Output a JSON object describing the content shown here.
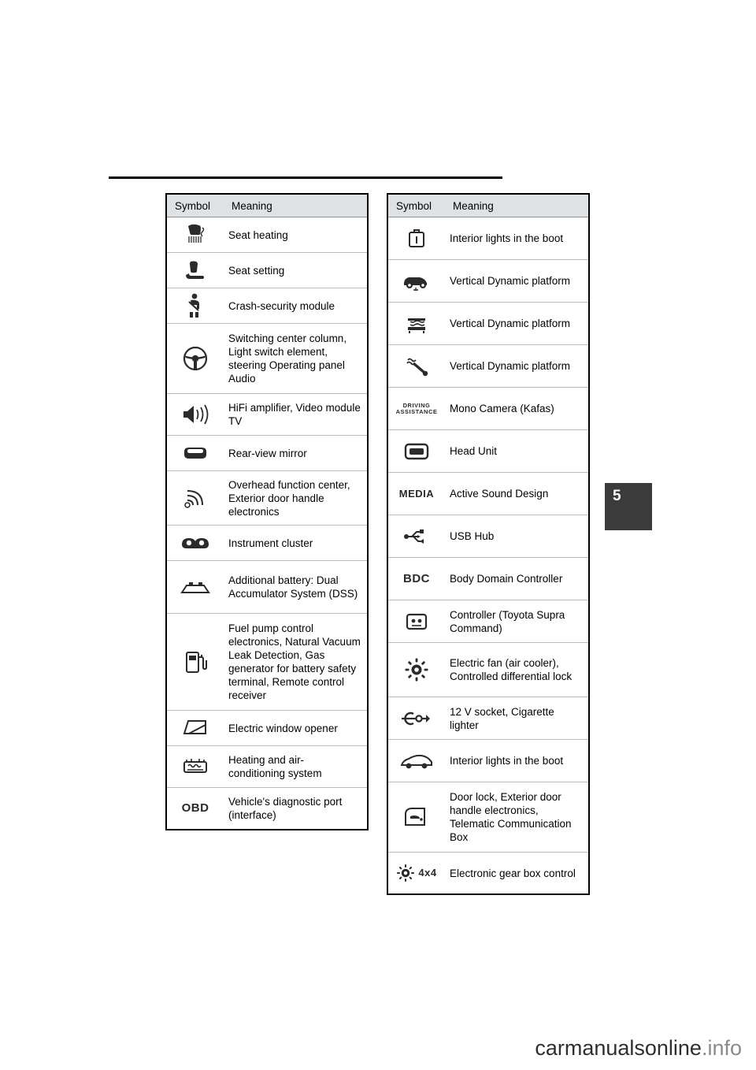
{
  "page": {
    "tab_number": "5",
    "watermark_main": "carmanualsonline",
    "watermark_suffix": ".info"
  },
  "tables": [
    {
      "id": "left",
      "header": {
        "symbol": "Symbol",
        "meaning": "Meaning"
      },
      "rows": [
        {
          "icon": "seat-heating-icon",
          "meaning": "Seat heating"
        },
        {
          "icon": "seat-setting-icon",
          "meaning": "Seat setting"
        },
        {
          "icon": "crash-security-module-icon",
          "meaning": "Crash-security module"
        },
        {
          "icon": "steering-wheel-icon",
          "meaning": "Switching center column, Light switch element, steering Operating panel Audio"
        },
        {
          "icon": "speaker-icon",
          "meaning": "HiFi amplifier, Video module TV"
        },
        {
          "icon": "rear-view-mirror-icon",
          "meaning": "Rear-view mirror"
        },
        {
          "icon": "antenna-signal-icon",
          "meaning": "Overhead function center, Exterior door handle electronics"
        },
        {
          "icon": "instrument-cluster-icon",
          "meaning": "Instrument cluster"
        },
        {
          "icon": "additional-battery-icon",
          "meaning": "Additional battery: Dual Accumulator System (DSS)"
        },
        {
          "icon": "fuel-pump-icon",
          "meaning": "Fuel pump control electronics, Natural Vacuum Leak Detection, Gas generator for battery safety terminal, Remote control receiver"
        },
        {
          "icon": "electric-window-opener-icon",
          "meaning": "Electric window opener"
        },
        {
          "icon": "heating-air-conditioning-icon",
          "meaning": "Heating and air-conditioning system"
        },
        {
          "icon": "obd-icon",
          "icon_label": "OBD",
          "meaning": "Vehicle's diagnostic port (interface)"
        }
      ]
    },
    {
      "id": "right",
      "header": {
        "symbol": "Symbol",
        "meaning": "Meaning"
      },
      "rows": [
        {
          "icon": "boot-light-icon",
          "meaning": "Interior lights in the boot"
        },
        {
          "icon": "vertical-dynamic-platform-car-icon",
          "meaning": "Vertical Dynamic platform"
        },
        {
          "icon": "vertical-dynamic-platform-suspension-icon",
          "meaning": "Vertical Dynamic platform"
        },
        {
          "icon": "vertical-dynamic-platform-damper-icon",
          "meaning": "Vertical Dynamic platform"
        },
        {
          "icon": "driving-assistance-icon",
          "icon_label": "DRIVING ASSISTANCE",
          "meaning": "Mono Camera (Kafas)"
        },
        {
          "icon": "head-unit-icon",
          "meaning": "Head Unit"
        },
        {
          "icon": "media-icon",
          "icon_label": "MEDIA",
          "meaning": "Active Sound Design"
        },
        {
          "icon": "usb-hub-icon",
          "meaning": "USB Hub"
        },
        {
          "icon": "bdc-icon",
          "icon_label": "BDC",
          "meaning": "Body Domain Controller"
        },
        {
          "icon": "controller-icon",
          "meaning": "Controller (Toyota Supra Command)"
        },
        {
          "icon": "electric-fan-icon",
          "meaning": "Electric fan (air cooler), Controlled differential lock"
        },
        {
          "icon": "socket-lighter-icon",
          "meaning": "12 V socket, Cigarette lighter"
        },
        {
          "icon": "interior-lights-boot-car-icon",
          "meaning": "Interior lights in the boot"
        },
        {
          "icon": "door-lock-icon",
          "meaning": "Door lock, Exterior door handle electronics, Telematic Communication Box"
        },
        {
          "icon": "gear-box-4x4-icon",
          "icon_label": "4x4",
          "meaning": "Electronic gear box control"
        }
      ]
    }
  ]
}
